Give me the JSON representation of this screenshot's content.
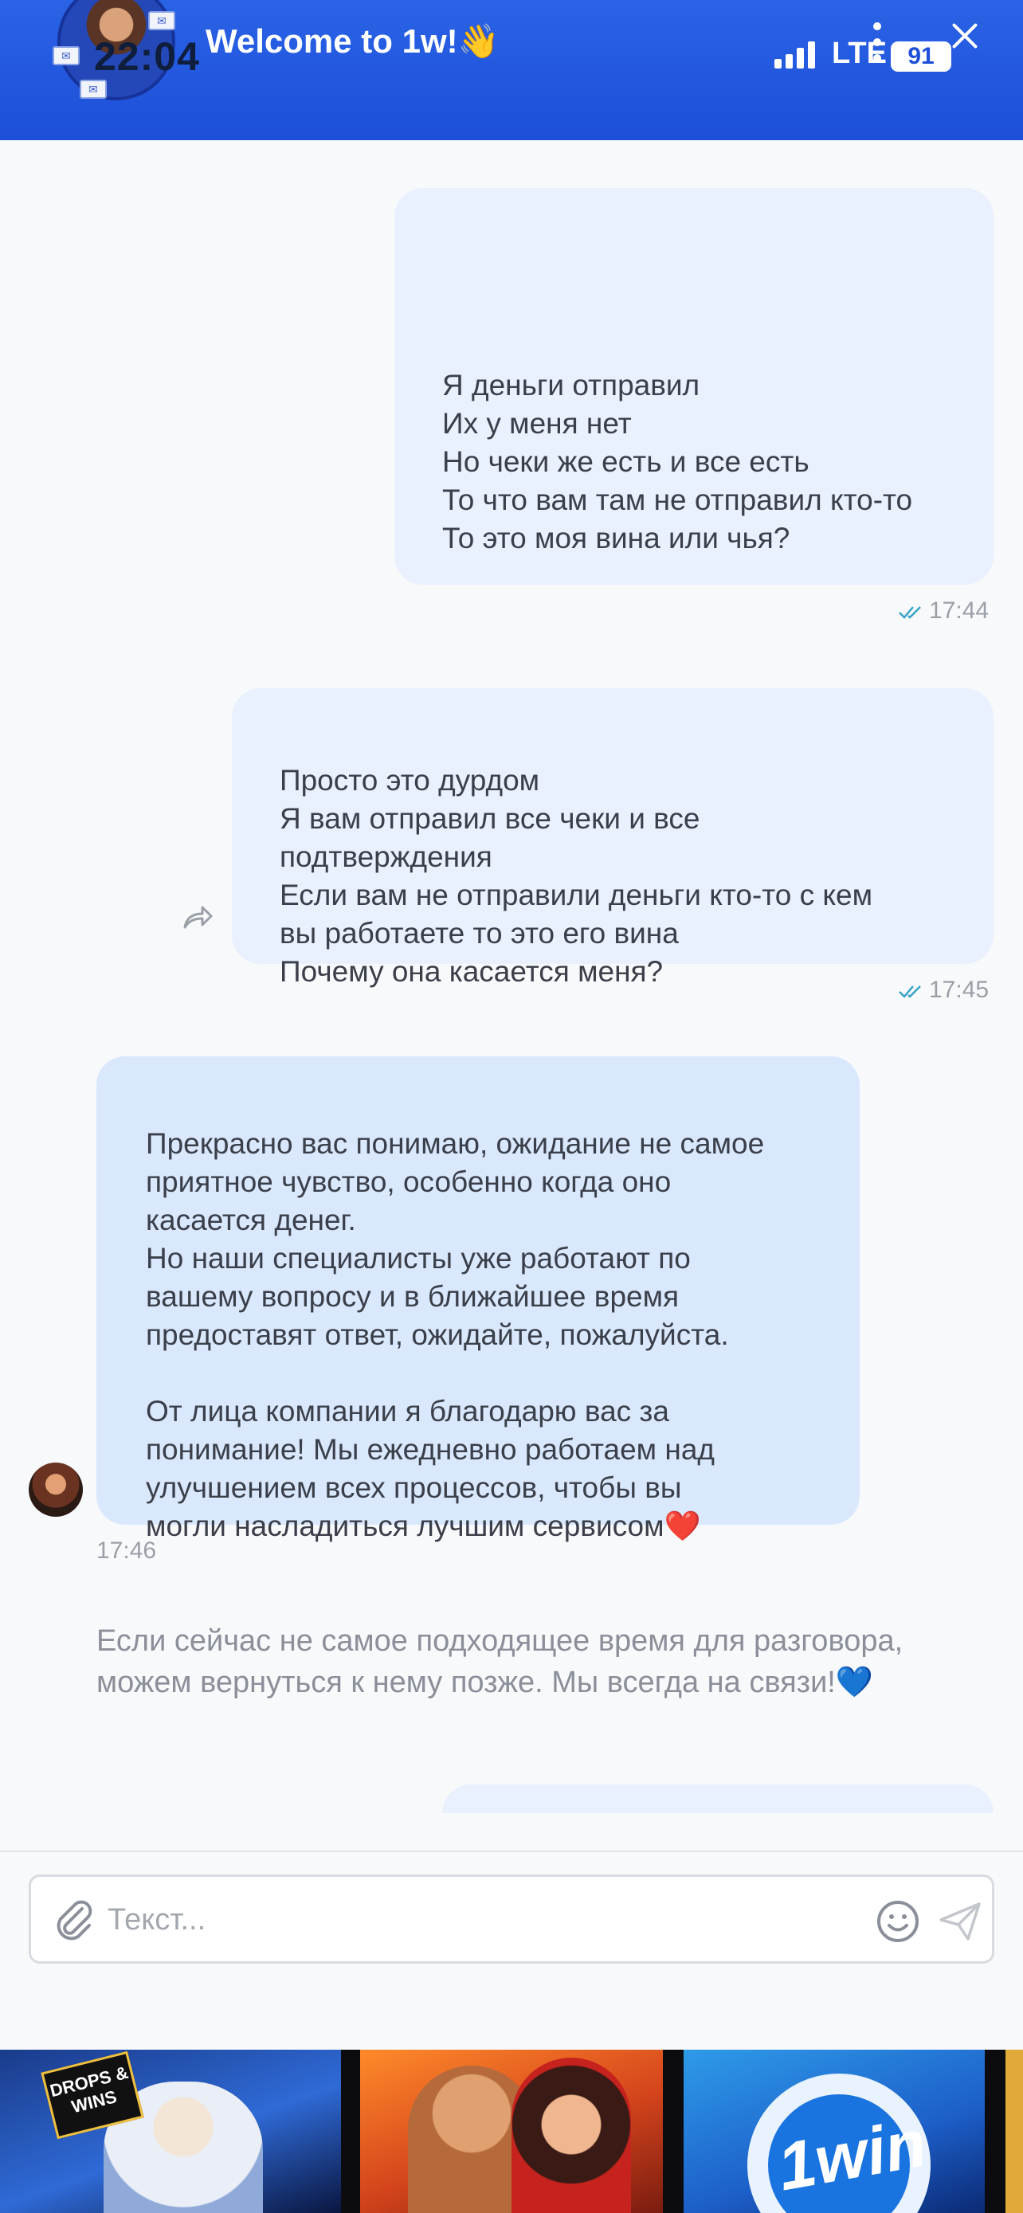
{
  "header": {
    "status_time": "22:04",
    "title": "Welcome to 1w!👋",
    "network": "LTE",
    "battery": "91"
  },
  "messages": [
    {
      "type": "outgoing",
      "text": "Я деньги отправил\nИх у меня нет\nНо чеки же есть и все есть\nТо что вам там не отправил кто-то\nТо это моя вина или чья?",
      "time": "17:44",
      "status": "read"
    },
    {
      "type": "outgoing",
      "text": "Просто это дурдом\nЯ вам отправил все чеки и все\nподтверждения\nЕсли вам не отправили деньги кто-то с кем\nвы работаете то это его вина\nПочему она касается меня?",
      "time": "17:45",
      "status": "read"
    },
    {
      "type": "incoming",
      "text": "Прекрасно вас понимаю, ожидание не самое\nприятное чувство, особенно когда оно\nкасается денег.\nНо наши специалисты уже работают по\nвашему вопросу и в ближайшее время\nпредоставят ответ, ожидайте, пожалуйста.\n\nОт лица компании я благодарю вас за\nпонимание! Мы ежедневно работаем над\nулучшением всех процессов, чтобы вы\nмогли насладиться лучшим сервисом❤️",
      "time": "17:46"
    },
    {
      "type": "system",
      "text": "Если сейчас не самое подходящее время для разговора,\nможем вернуться к нему позже. Мы всегда на связи!💙"
    },
    {
      "type": "outgoing",
      "text": "",
      "partial": true
    }
  ],
  "composer": {
    "placeholder": "Текст..."
  },
  "banner": {
    "tiles": [
      "DROPS & WINS",
      "",
      "1win"
    ]
  },
  "colors": {
    "header_bg": "#1d4fd8",
    "outgoing_bubble": "#e9f0fe",
    "incoming_bubble": "#d9e8fd",
    "read_ticks": "#3aa3c8"
  }
}
